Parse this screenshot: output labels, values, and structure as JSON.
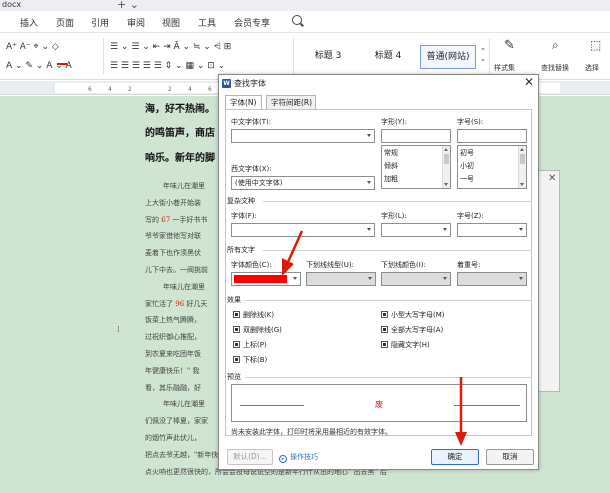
{
  "window": {
    "doc_tab": "docx",
    "new_tab": "+ ⌄"
  },
  "menubar": {
    "items": [
      "插入",
      "页面",
      "引用",
      "审阅",
      "视图",
      "工具",
      "会员专享"
    ]
  },
  "ribbon": {
    "row1_left": "A⁺  A⁻  ⌖ ⌄  ◇",
    "row1_mid": "☰ ⌄  ☰ ⌄   ⇤  ⇥   Ā ⌄   ≒ ⌄   ⩤   ⊞",
    "row2_left": "A ⌄   ✎ ⌄   A ⌄   A",
    "row2_mid": "☰  ☰  ☰  ☰  ☰   ⇕ ⌄   ▦ ⌄   ⊡ ⌄",
    "styles": [
      "标题 3",
      "标题 4",
      "普通(网站)"
    ],
    "style_set": "样式集",
    "find_replace": "查找替换",
    "select": "选择"
  },
  "ruler": {
    "numbers": [
      "6",
      "4",
      "2",
      "2",
      "4",
      "6"
    ]
  },
  "document": {
    "bold_lines": [
      "海，好不热闹。",
      "的鸣笛声，商店",
      "响乐。新年的脚"
    ],
    "body_lines": [
      "年味儿在潮里",
      "上大街小巷开始装",
      "写的 67 一手好书书",
      "爷爷家借他写对联",
      "麦着下也作须黑伏",
      "儿下中去。一阀挑前",
      "年味儿在潮里",
      "家忙活了 96 好几天",
      "饭菜上热气腾腾，",
      "过祝织御心推配，",
      "到农夏来吃团年饭",
      "年健康快乐！\" 我",
      "看，其乐融融，好",
      "年味儿在潮里",
      "们佩没了棒夏，家家",
      "的烟竹声此伏儿，",
      "把点去爷无越，\"新年快乐\"祝福的声音，\"出天蓝\"出一在备主人来接源天的，鞭杯的",
      "点火响也更然很快的，所会会投母说说空的是新年行什从出的地心\" 出去黑\" 后"
    ],
    "red_numbers": [
      "67",
      "96"
    ]
  },
  "dialog": {
    "icon_letter": "W",
    "title": "查找字体",
    "tabs": [
      "字体(N)",
      "字符间距(R)"
    ],
    "labels": {
      "chinese_font": "中文字体(T):",
      "style": "字形(Y):",
      "size": "字号(S):",
      "western_font": "西文字体(X):",
      "complex_section": "复杂文种",
      "complex_font": "字体(F):",
      "complex_style": "字形(L):",
      "complex_size": "字号(Z):",
      "all_text": "所有文字",
      "font_color": "字体颜色(C):",
      "underline_type": "下划线线型(U):",
      "underline_color": "下划线颜色(I):",
      "emphasis": "着重号:",
      "effects": "效果",
      "preview": "预览"
    },
    "western_font_value": "(使用中文字体)",
    "style_list": [
      "常规",
      "倾斜",
      "加粗"
    ],
    "size_list": [
      "初号",
      "小初",
      "一号"
    ],
    "font_color_value": "#ff0000",
    "effects": {
      "strikethrough": "删除线(K)",
      "double_strikethrough": "双删除线(G)",
      "superscript": "上标(P)",
      "subscript": "下标(B)",
      "small_caps": "小型大写字母(M)",
      "all_caps": "全部大写字母(A)",
      "hidden": "隐藏文字(H)"
    },
    "preview_glyph": "废",
    "hint": "尚未安装此字体，打印时将采用最相近的有效字体。",
    "buttons": {
      "default": "默认(D)...",
      "tips": "操作技巧",
      "ok": "确定",
      "cancel": "取消"
    }
  },
  "annotations": {
    "arrow_color": "#d81e06"
  }
}
